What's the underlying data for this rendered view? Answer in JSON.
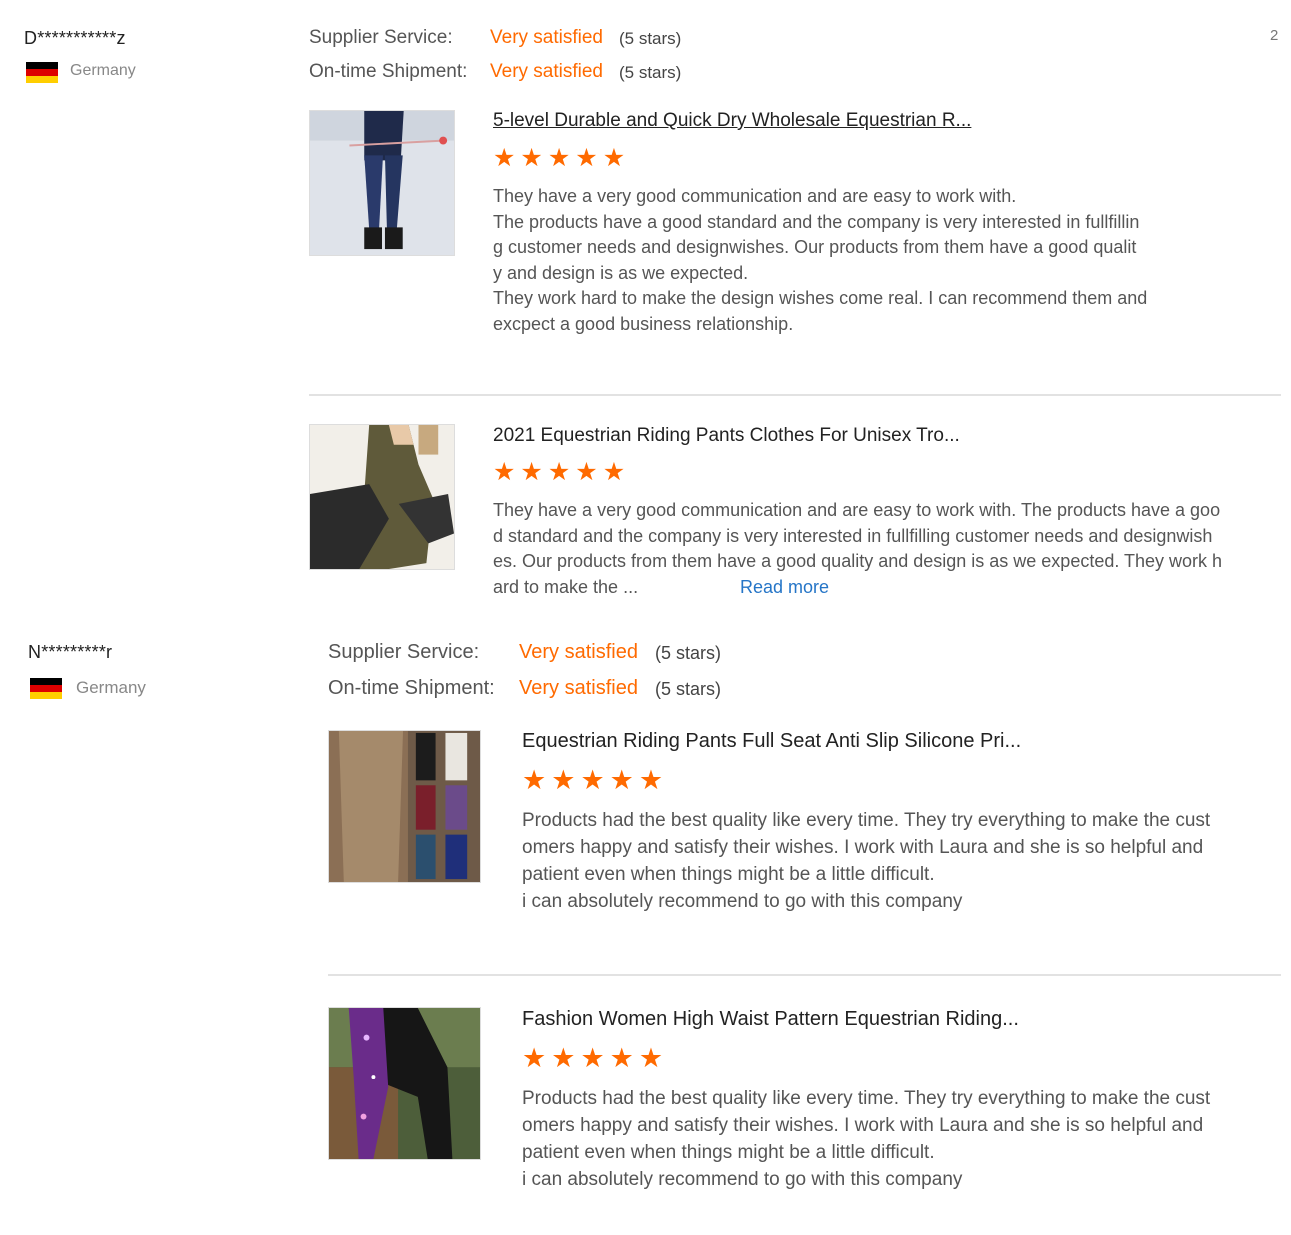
{
  "page": {
    "page_number": "2"
  },
  "reviews": [
    {
      "name": "D***********z",
      "country": "Germany",
      "ratings": [
        {
          "label": "Supplier Service:",
          "value": "Very satisfied",
          "stars": "(5 stars)"
        },
        {
          "label": "On-time Shipment:",
          "value": "Very satisfied",
          "stars": "(5 stars)"
        }
      ],
      "products": [
        {
          "title": "5-level Durable and Quick Dry Wholesale Equestrian R...",
          "stars": 5,
          "text": "They have a very good communication and are easy to work with.\nThe products have a good standard and the company is very interested in fullfillin\ng customer needs and designwishes. Our products from them have a good qualit\ny and design is as we expected.\nThey work hard to make the design wishes come real. I can recommend them and\nexcpect a good business relationship."
        },
        {
          "title": "2021 Equestrian Riding Pants Clothes For Unisex Tro...",
          "stars": 5,
          "text": "They have a very good communication and are easy to work with. The products have a goo\nd standard and the company is very interested in fullfilling customer needs and designwish\nes. Our products from them have a good quality and design is as we expected. They work h\nard to make the ...",
          "read_more": "Read more"
        }
      ]
    },
    {
      "name": "N*********r",
      "country": "Germany",
      "ratings": [
        {
          "label": "Supplier Service:",
          "value": "Very satisfied",
          "stars": "(5 stars)"
        },
        {
          "label": "On-time Shipment:",
          "value": "Very satisfied",
          "stars": "(5 stars)"
        }
      ],
      "products": [
        {
          "title": "Equestrian Riding Pants Full Seat Anti Slip Silicone Pri...",
          "stars": 5,
          "text": "Products had the best quality like every time. They try everything to make the cust\nomers happy and satisfy their wishes. I work with Laura and she is so helpful and\npatient even when things might be a little difficult.\ni can absolutely recommend to go with this company"
        },
        {
          "title": "Fashion Women High Waist Pattern Equestrian Riding...",
          "stars": 5,
          "text": "Products had the best quality like every time. They try everything to make the cust\nomers happy and satisfy their wishes. I work with Laura and she is so helpful and\npatient even when things might be a little difficult.\ni can absolutely recommend to go with this company"
        }
      ]
    }
  ],
  "colors": {
    "accent": "#ff6a00",
    "link": "#2575c7",
    "muted": "#888888",
    "divider": "#e2e2e2"
  },
  "icons": {
    "star": "star-icon",
    "flag": "germany-flag-icon"
  }
}
